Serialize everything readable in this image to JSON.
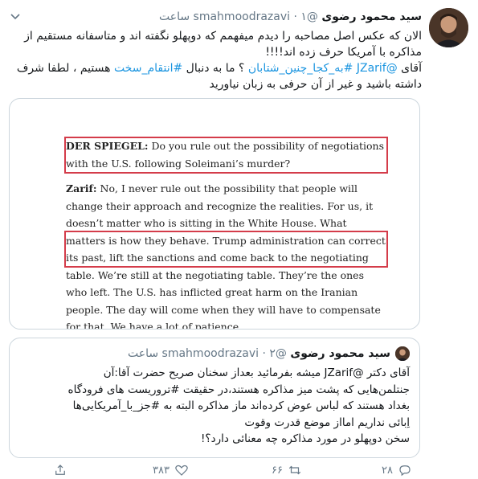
{
  "tweet": {
    "author_name": "سید محمود رضوی",
    "author_handle": "@smahmoodrazavi",
    "separator": "·",
    "time": "۱ ساعت",
    "text_line1": "الان که عکس اصل مصاحبه را دیدم میفهمم که دوپهلو نگفته اند و متاسفانه مستقیم از مذاکره با آمریکا حرف زده اند!!!!",
    "text_line2_prefix": "آقای ",
    "mention": "@JZarif",
    "hashtag1": "#به_کجا_چنین_شتابان",
    "text_line2_mid": " ؟ ما به دنبال ",
    "hashtag2": "#انتقام_سخت",
    "text_line2_suffix": " هستیم ، لطفا شرف داشته باشید و غیر از آن حرفی به زبان نیاورید"
  },
  "image_doc": {
    "q_label": "DER SPIEGEL:",
    "q_text": " Do you rule out the possibility of negotiations with the U.S. following Soleimani’s murder?",
    "a_label": "Zarif:",
    "a_text1": " No, I never rule out the possibility that people will change their approach and recognize the realities. For us, it doesn’t matter who is sitting in the White House. What matters is how they behave. ",
    "a_text2": "Trump administration can correct its past, lift the sanctions and come back to the negotiating table. We’re still at the negotiating table.",
    "a_text3": " They’re the ones who left. The U.S. has inflicted great harm on the Iranian people. The day will come when they will have to compensate for that. We have a lot of patience."
  },
  "quoted": {
    "author_name": "سید محمود رضوی",
    "author_handle": "@smahmoodrazavi",
    "separator": "·",
    "time": "۲ ساعت",
    "line1": "آقای دکتر @JZarif میشه بفرمائید بعداز سخنان صریح حضرت آقا:آن",
    "line2": "جنتلمن‌هایی که پشت میز مذاکره هستند،در حقیقت #تروریست های فرودگاه",
    "line3": "بغداد هستند که لباس عوض کرده‌اند ماز مذاکره البته به #جز_با_آمریکایی‌ها",
    "line4": "اِبائی نداریم امااز موضع قدرت وقوت",
    "line5": "سخن دوپهلو در مورد مذاکره چه معنائی دارد؟!"
  },
  "actions": {
    "reply_count": "۲۸",
    "retweet_count": "۶۶",
    "like_count": "۳۸۳"
  },
  "colors": {
    "link": "#1b95e0",
    "muted": "#657786",
    "highlight_box": "#d43c4a"
  }
}
